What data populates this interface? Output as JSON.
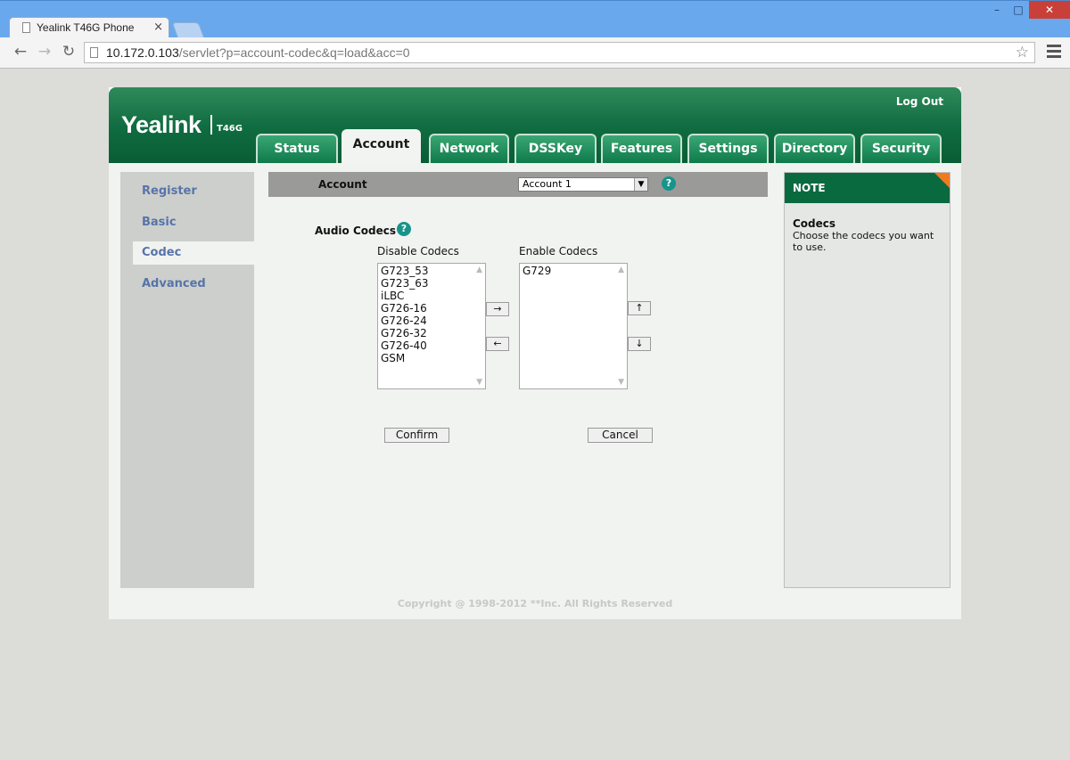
{
  "browser": {
    "tab_title": "Yealink T46G Phone",
    "tab_close": "×",
    "url_host": "10.172.0.103",
    "url_path": "/servlet?p=account-codec&q=load&acc=0",
    "window_controls": {
      "minimize": "–",
      "maximize": "□",
      "close": "✕"
    }
  },
  "header": {
    "logo": "Yealink",
    "model": "T46G",
    "logout": "Log Out",
    "tabs": [
      {
        "label": "Status"
      },
      {
        "label": "Account",
        "active": true
      },
      {
        "label": "Network"
      },
      {
        "label": "DSSKey"
      },
      {
        "label": "Features"
      },
      {
        "label": "Settings"
      },
      {
        "label": "Directory"
      },
      {
        "label": "Security"
      }
    ]
  },
  "sidebar": {
    "items": [
      {
        "label": "Register"
      },
      {
        "label": "Basic"
      },
      {
        "label": "Codec",
        "active": true
      },
      {
        "label": "Advanced"
      }
    ]
  },
  "main": {
    "account_label": "Account",
    "account_selected": "Account 1",
    "help_icon": "?",
    "section_title": "Audio Codecs",
    "disable_label": "Disable Codecs",
    "enable_label": "Enable Codecs",
    "disabled_codecs": [
      "G723_53",
      "G723_63",
      "iLBC",
      "G726-16",
      "G726-24",
      "G726-32",
      "G726-40",
      "GSM"
    ],
    "enabled_codecs": [
      "G729"
    ],
    "move_right": "→",
    "move_left": "←",
    "move_up": "↑",
    "move_down": "↓",
    "confirm": "Confirm",
    "cancel": "Cancel"
  },
  "note": {
    "heading": "NOTE",
    "title": "Codecs",
    "text": "Choose the codecs you want to use."
  },
  "footer": {
    "copyright": "Copyright @ 1998-2012 **Inc. All Rights Reserved"
  },
  "colors": {
    "header_green": "#0f6b40",
    "sidebar_link": "#5774a8",
    "note_accent": "#ef7a1f",
    "help_teal": "#17948a"
  }
}
